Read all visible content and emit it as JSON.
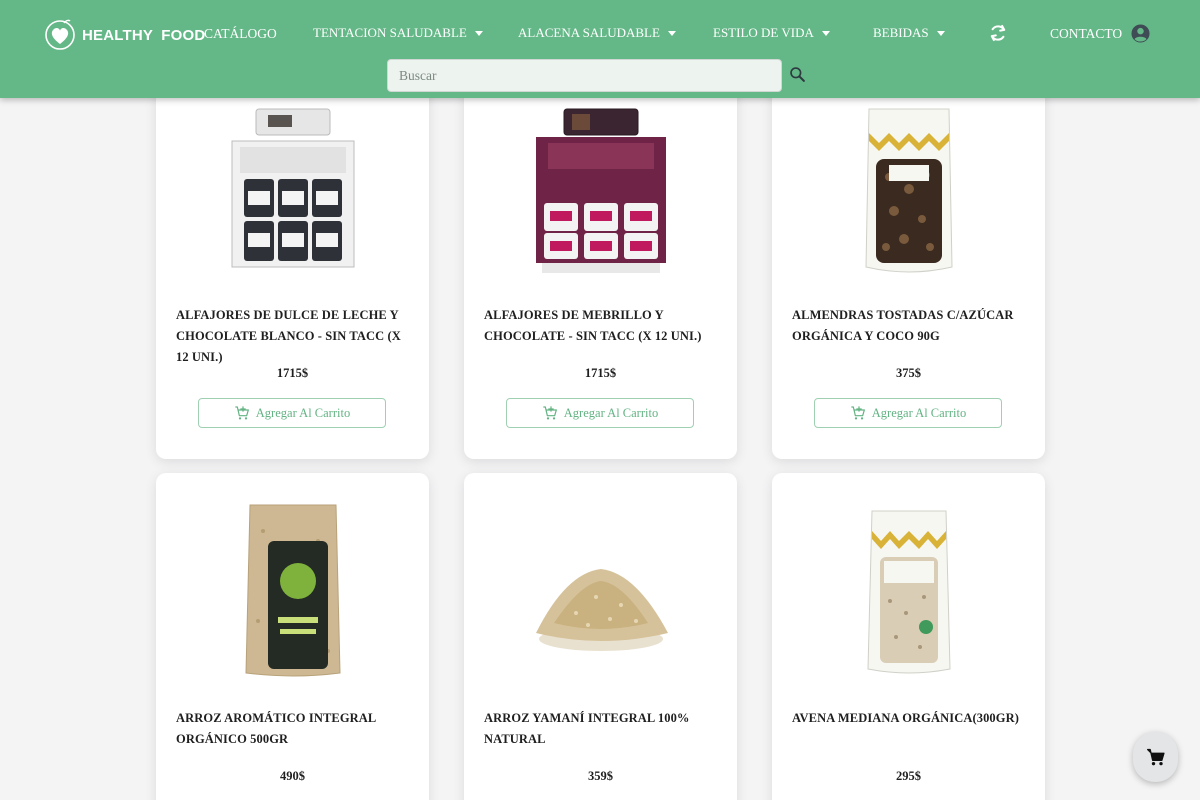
{
  "header": {
    "brand": "HEALTHY FOOD",
    "nav": {
      "catalogo": "CATÁLOGO",
      "tentacion": "TENTACION SALUDABLE",
      "alacena": "ALACENA SALUDABLE",
      "estilo": "ESTILO DE VIDA",
      "bebidas": "BEBIDAS",
      "contacto": "CONTACTO"
    },
    "search": {
      "placeholder": "Buscar",
      "value": ""
    },
    "colors": {
      "header_bg": "#64b887",
      "accent": "#63b383"
    }
  },
  "products": [
    {
      "name": "ALFAJORES DE DULCE DE LECHE Y CHOCOLATE BLANCO - SIN TACC (X 12 UNI.)",
      "price": "1715$",
      "button": "Agregar Al Carrito",
      "image": "boxed-alfajores-white"
    },
    {
      "name": "ALFAJORES DE MEBRILLO Y CHOCOLATE - SIN TACC (X 12 UNI.)",
      "price": "1715$",
      "button": "Agregar Al Carrito",
      "image": "boxed-alfajores-maroon"
    },
    {
      "name": "ALMENDRAS TOSTADAS C/AZÚCAR ORGÁNICA Y COCO 90G",
      "price": "375$",
      "button": "Agregar Al Carrito",
      "image": "bag-almonds"
    },
    {
      "name": "ARROZ AROMÁTICO INTEGRAL ORGÁNICO 500GR",
      "price": "490$",
      "image": "bag-rice-pampas"
    },
    {
      "name": "ARROZ YAMANÍ INTEGRAL 100% NATURAL",
      "price": "359$",
      "image": "rice-pile"
    },
    {
      "name": "AVENA MEDIANA ORGÁNICA(300GR)",
      "price": "295$",
      "image": "bag-oats"
    }
  ],
  "icons": {
    "refresh": "refresh-icon",
    "user": "user-icon",
    "search": "search-icon",
    "add_cart": "add-cart-icon",
    "cart": "cart-icon"
  }
}
